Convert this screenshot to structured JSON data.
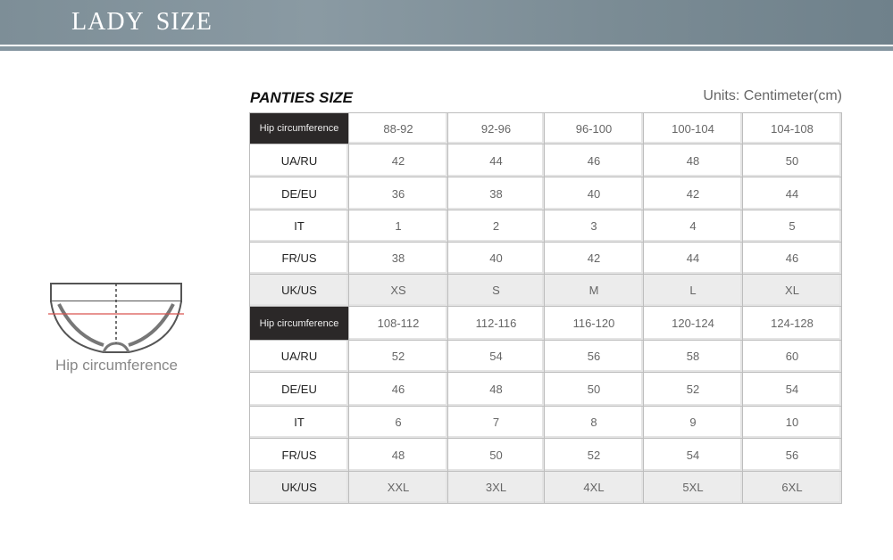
{
  "banner": {
    "title": "LADY  SIZE"
  },
  "section": {
    "title": "PANTIES SIZE",
    "units": "Units: Centimeter(cm)"
  },
  "illustration": {
    "label": "Hip circumference",
    "icon": "panties-outline-icon"
  },
  "tables": [
    {
      "header_label": "Hip circumference",
      "hip_ranges": [
        "88-92",
        "92-96",
        "96-100",
        "100-104",
        "104-108"
      ],
      "rows": [
        {
          "label": "UA/RU",
          "values": [
            "42",
            "44",
            "46",
            "48",
            "50"
          ]
        },
        {
          "label": "DE/EU",
          "values": [
            "36",
            "38",
            "40",
            "42",
            "44"
          ]
        },
        {
          "label": "IT",
          "values": [
            "1",
            "2",
            "3",
            "4",
            "5"
          ]
        },
        {
          "label": "FR/US",
          "values": [
            "38",
            "40",
            "42",
            "44",
            "46"
          ]
        },
        {
          "label": "UK/US",
          "values": [
            "XS",
            "S",
            "M",
            "L",
            "XL"
          ]
        }
      ]
    },
    {
      "header_label": "Hip circumference",
      "hip_ranges": [
        "108-112",
        "112-116",
        "116-120",
        "120-124",
        "124-128"
      ],
      "rows": [
        {
          "label": "UA/RU",
          "values": [
            "52",
            "54",
            "56",
            "58",
            "60"
          ]
        },
        {
          "label": "DE/EU",
          "values": [
            "46",
            "48",
            "50",
            "52",
            "54"
          ]
        },
        {
          "label": "IT",
          "values": [
            "6",
            "7",
            "8",
            "9",
            "10"
          ]
        },
        {
          "label": "FR/US",
          "values": [
            "48",
            "50",
            "52",
            "54",
            "56"
          ]
        },
        {
          "label": "UK/US",
          "values": [
            "XXL",
            "3XL",
            "4XL",
            "5XL",
            "6XL"
          ]
        }
      ]
    }
  ],
  "colors": {
    "banner": "#7d8e97",
    "header_cell": "#2b2828",
    "highlight_row": "#ececec",
    "measure_line": "#d9534f"
  }
}
